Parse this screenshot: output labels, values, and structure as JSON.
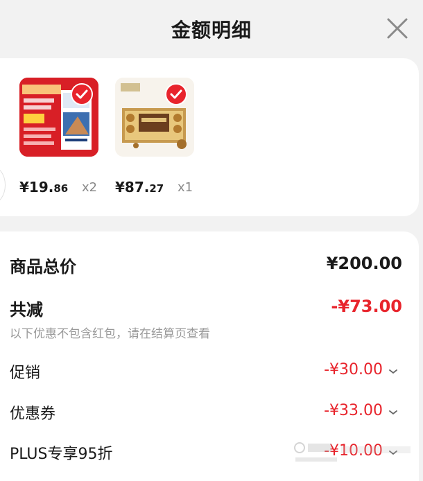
{
  "header": {
    "title": "金额明细",
    "close_icon": "close-icon"
  },
  "products": [
    {
      "price_main": "¥19.",
      "price_decimal": "86",
      "qty": "x2",
      "selected": true
    },
    {
      "price_main": "¥87.",
      "price_decimal": "27",
      "qty": "x1",
      "selected": true
    }
  ],
  "summary": {
    "total_label": "商品总价",
    "total_value": "¥200.00",
    "discount_label": "共减",
    "discount_value": "-¥73.00",
    "note": "以下优惠不包含红包，请在结算页查看",
    "items": [
      {
        "label": "促销",
        "value": "-¥30.00"
      },
      {
        "label": "优惠券",
        "value": "-¥33.00"
      },
      {
        "label": "PLUS专享95折",
        "value": "-¥10.00"
      }
    ]
  },
  "colors": {
    "accent": "#e8242c",
    "muted": "#999999"
  }
}
